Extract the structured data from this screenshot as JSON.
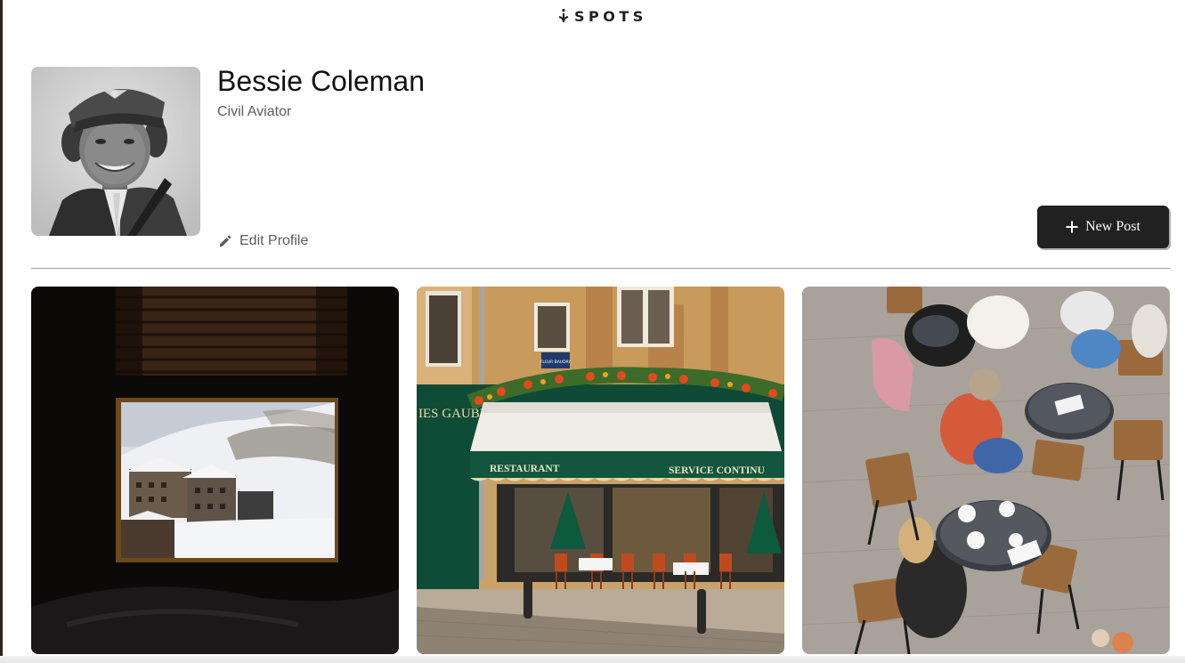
{
  "header": {
    "logo_text": "SPOTS"
  },
  "profile": {
    "name": "Bessie Coleman",
    "description": "Civil Aviator",
    "edit_label": "Edit Profile"
  },
  "actions": {
    "new_post_label": "New Post"
  },
  "cards": {
    "restaurant_awning_text": "RESTAURANT",
    "service_awning_text": "SERVICE CONTINU",
    "shop_sign_text": "IES GAUBERT",
    "street_sign_text": "FLEUR BAUDRY"
  }
}
